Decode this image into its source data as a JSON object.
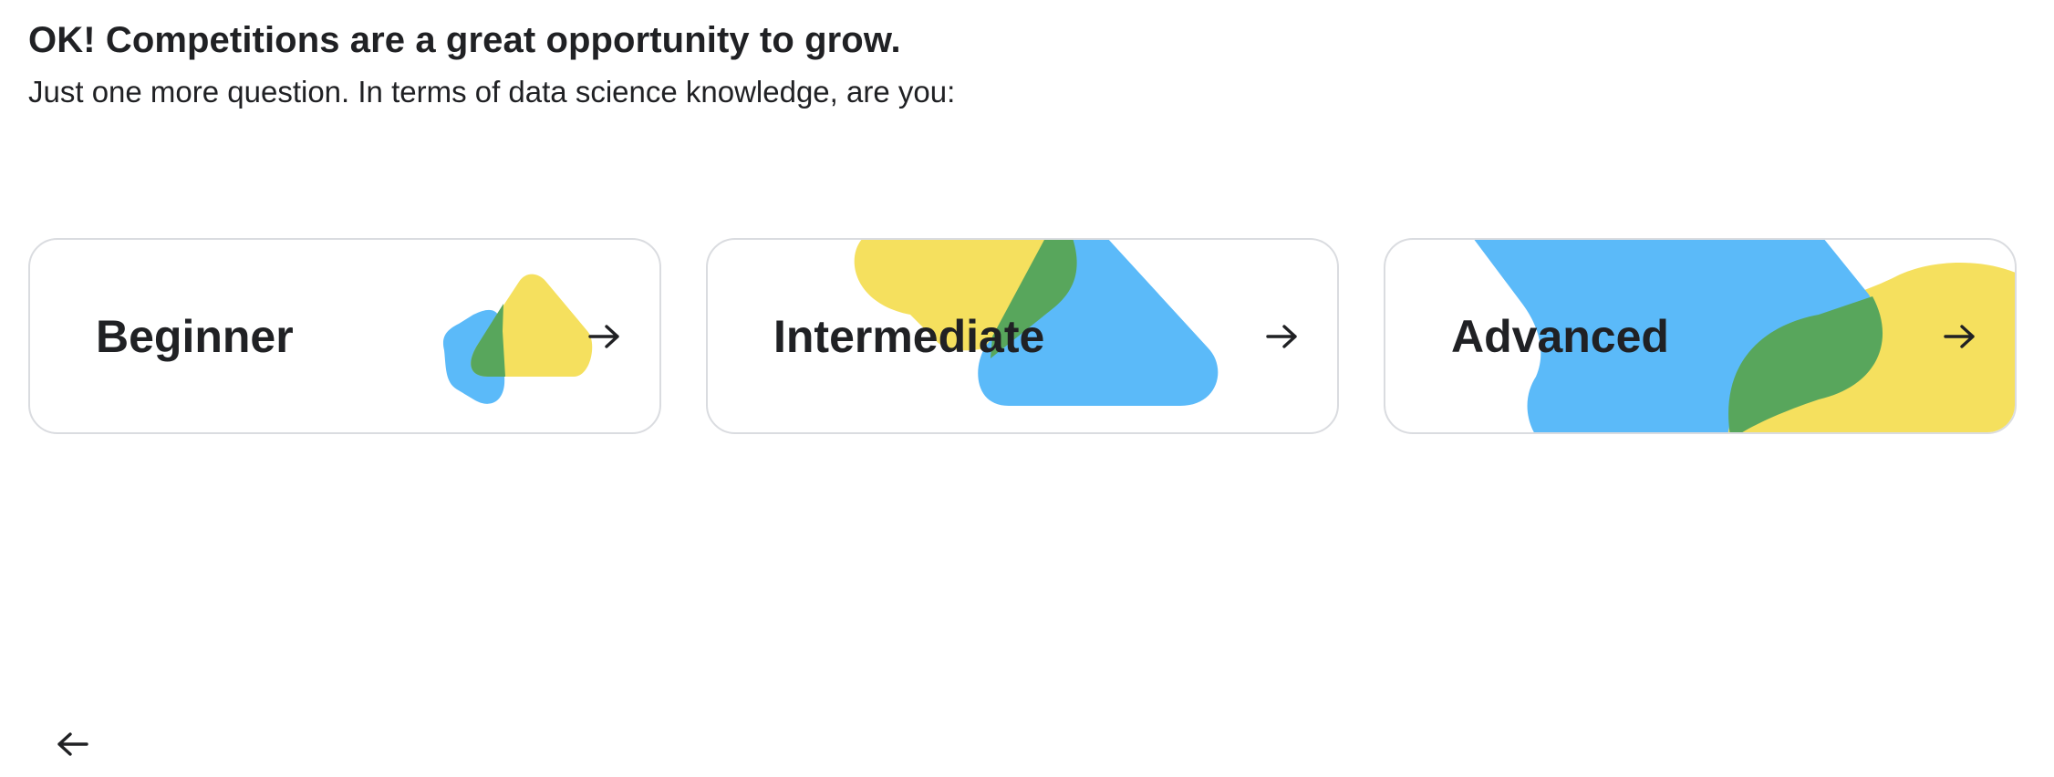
{
  "header": {
    "title": "OK! Competitions are a great opportunity to grow.",
    "subtitle": "Just one more question. In terms of data science knowledge, are you:"
  },
  "options": [
    {
      "label": "Beginner",
      "icon": "arrow-right-icon"
    },
    {
      "label": "Intermediate",
      "icon": "arrow-right-icon"
    },
    {
      "label": "Advanced",
      "icon": "arrow-right-icon"
    }
  ],
  "navigation": {
    "back_icon": "arrow-left-icon"
  },
  "colors": {
    "blue": "#5bbaf9",
    "yellow": "#f5e05e",
    "green": "#58a65c",
    "border": "#dadce0",
    "text": "#202124"
  }
}
